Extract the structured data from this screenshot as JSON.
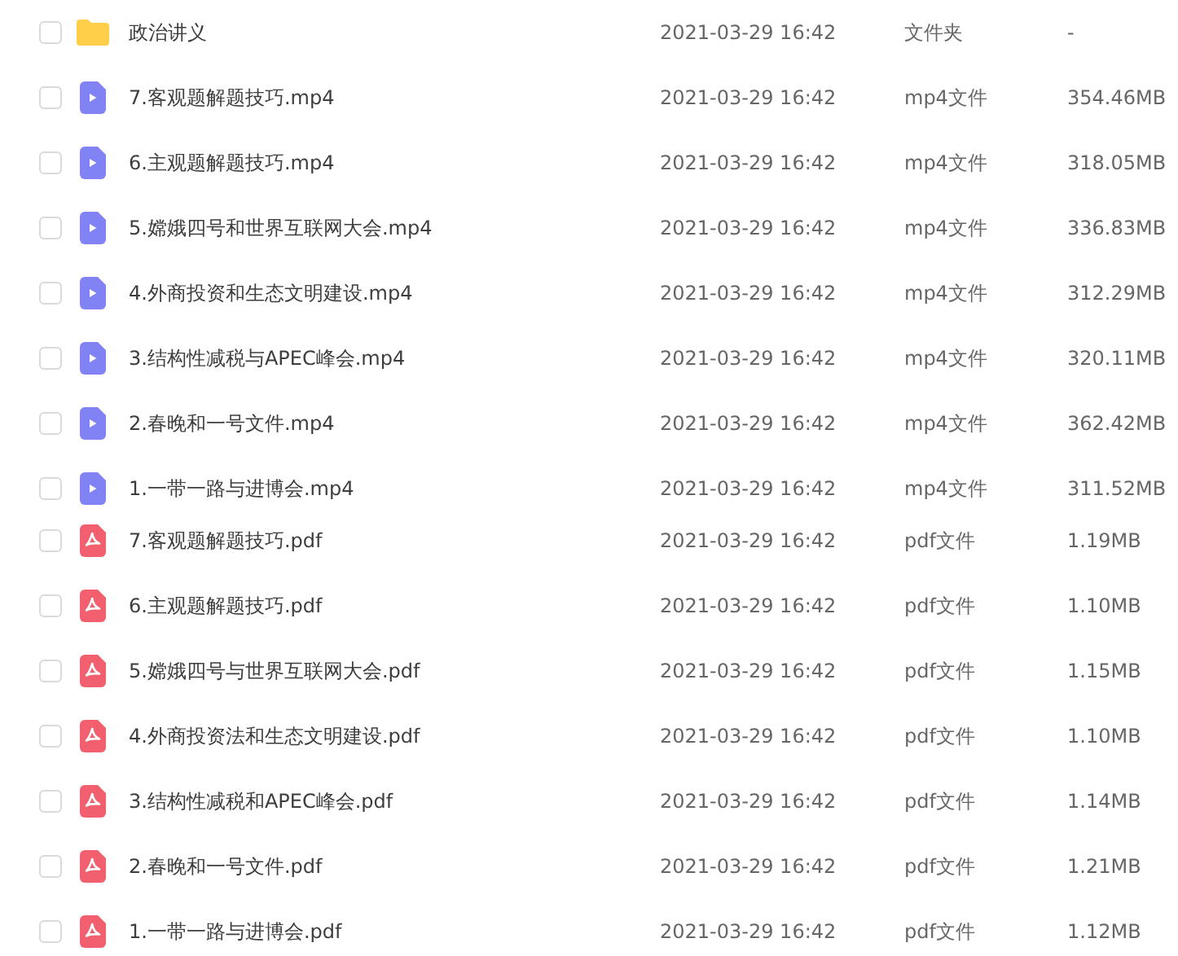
{
  "files": [
    {
      "kind": "folder",
      "name": "政治讲义",
      "modified": "2021-03-29 16:42",
      "type": "文件夹",
      "size": "-",
      "checked": false
    },
    {
      "kind": "video",
      "name": "7.客观题解题技巧.mp4",
      "modified": "2021-03-29 16:42",
      "type": "mp4文件",
      "size": "354.46MB",
      "checked": false
    },
    {
      "kind": "video",
      "name": "6.主观题解题技巧.mp4",
      "modified": "2021-03-29 16:42",
      "type": "mp4文件",
      "size": "318.05MB",
      "checked": false
    },
    {
      "kind": "video",
      "name": "5.嫦娥四号和世界互联网大会.mp4",
      "modified": "2021-03-29 16:42",
      "type": "mp4文件",
      "size": "336.83MB",
      "checked": false
    },
    {
      "kind": "video",
      "name": "4.外商投资和生态文明建设.mp4",
      "modified": "2021-03-29 16:42",
      "type": "mp4文件",
      "size": "312.29MB",
      "checked": false
    },
    {
      "kind": "video",
      "name": "3.结构性减税与APEC峰会.mp4",
      "modified": "2021-03-29 16:42",
      "type": "mp4文件",
      "size": "320.11MB",
      "checked": false
    },
    {
      "kind": "video",
      "name": "2.春晚和一号文件.mp4",
      "modified": "2021-03-29 16:42",
      "type": "mp4文件",
      "size": "362.42MB",
      "checked": false
    },
    {
      "kind": "video",
      "name": "1.一带一路与进博会.mp4",
      "modified": "2021-03-29 16:42",
      "type": "mp4文件",
      "size": "311.52MB",
      "checked": false
    },
    {
      "kind": "pdf",
      "name": "7.客观题解题技巧.pdf",
      "modified": "2021-03-29 16:42",
      "type": "pdf文件",
      "size": "1.19MB",
      "checked": false
    },
    {
      "kind": "pdf",
      "name": "6.主观题解题技巧.pdf",
      "modified": "2021-03-29 16:42",
      "type": "pdf文件",
      "size": "1.10MB",
      "checked": false
    },
    {
      "kind": "pdf",
      "name": "5.嫦娥四号与世界互联网大会.pdf",
      "modified": "2021-03-29 16:42",
      "type": "pdf文件",
      "size": "1.15MB",
      "checked": false
    },
    {
      "kind": "pdf",
      "name": "4.外商投资法和生态文明建设.pdf",
      "modified": "2021-03-29 16:42",
      "type": "pdf文件",
      "size": "1.10MB",
      "checked": false
    },
    {
      "kind": "pdf",
      "name": "3.结构性减税和APEC峰会.pdf",
      "modified": "2021-03-29 16:42",
      "type": "pdf文件",
      "size": "1.14MB",
      "checked": false
    },
    {
      "kind": "pdf",
      "name": "2.春晚和一号文件.pdf",
      "modified": "2021-03-29 16:42",
      "type": "pdf文件",
      "size": "1.21MB",
      "checked": false
    },
    {
      "kind": "pdf",
      "name": "1.一带一路与进博会.pdf",
      "modified": "2021-03-29 16:42",
      "type": "pdf文件",
      "size": "1.12MB",
      "checked": false
    }
  ]
}
